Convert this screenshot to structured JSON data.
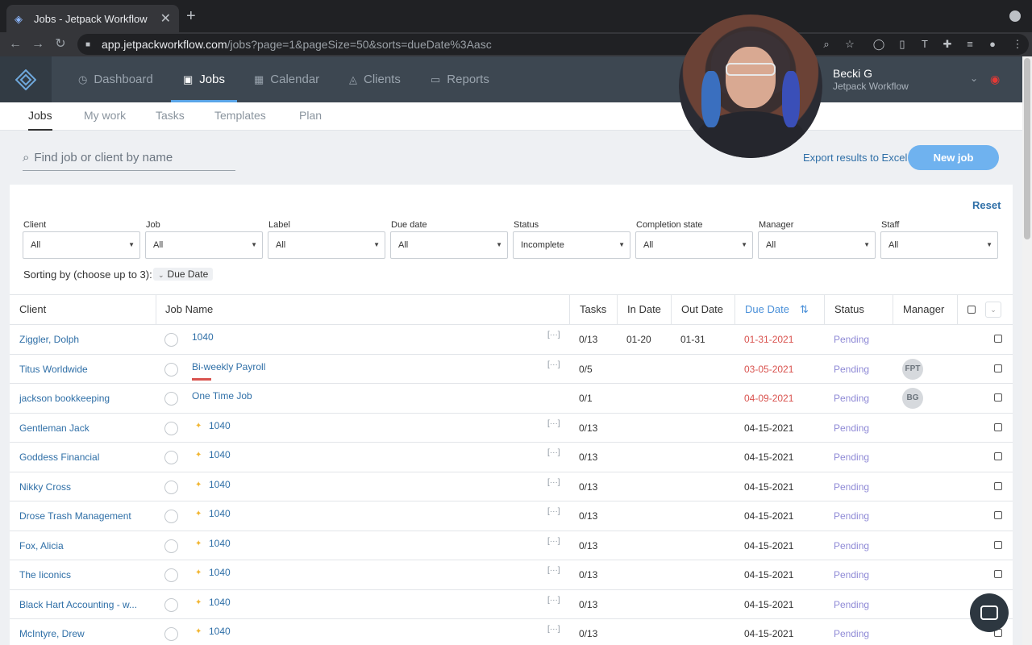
{
  "browser": {
    "tab_title": "Jobs - Jetpack Workflow",
    "url_host": "app.jetpackworkflow.com",
    "url_path": "/jobs?page=1&pageSize=50&sorts=dueDate%3Aasc"
  },
  "header": {
    "nav": [
      "Dashboard",
      "Jobs",
      "Calendar",
      "Clients",
      "Reports"
    ],
    "active_nav": "Jobs",
    "user_name": "Becki G",
    "user_org": "Jetpack Workflow"
  },
  "subnav": [
    "Jobs",
    "My work",
    "Tasks",
    "Templates",
    "Plan"
  ],
  "toolbar": {
    "search_placeholder": "Find job or client by name",
    "export_label": "Export results to Excel",
    "new_job_label": "New job"
  },
  "filters": {
    "reset_label": "Reset",
    "items": [
      {
        "label": "Client",
        "value": "All"
      },
      {
        "label": "Job",
        "value": "All"
      },
      {
        "label": "Label",
        "value": "All"
      },
      {
        "label": "Due date",
        "value": "All"
      },
      {
        "label": "Status",
        "value": "Incomplete"
      },
      {
        "label": "Completion state",
        "value": "All"
      },
      {
        "label": "Manager",
        "value": "All"
      },
      {
        "label": "Staff",
        "value": "All"
      }
    ],
    "sort_label": "Sorting by (choose up to 3):",
    "sort_chip": "Due Date"
  },
  "table": {
    "headers": {
      "client": "Client",
      "job_name": "Job Name",
      "tasks": "Tasks",
      "in_date": "In Date",
      "out_date": "Out Date",
      "due_date": "Due Date",
      "status": "Status",
      "manager": "Manager"
    },
    "rows": [
      {
        "client": "Ziggler, Dolph",
        "job": "1040",
        "tasks": "0/13",
        "in": "01-20",
        "out": "01-31",
        "due": "01-31-2021",
        "status": "Pending",
        "manager": ""
      },
      {
        "client": "Titus Worldwide",
        "job": "Bi-weekly Payroll",
        "tasks": "0/5",
        "in": "",
        "out": "",
        "due": "03-05-2021",
        "status": "Pending",
        "manager": "FPT"
      },
      {
        "client": "jackson bookkeeping",
        "job": "One Time Job",
        "tasks": "0/1",
        "in": "",
        "out": "",
        "due": "04-09-2021",
        "status": "Pending",
        "manager": "BG"
      },
      {
        "client": "Gentleman Jack",
        "job": "1040",
        "tasks": "0/13",
        "in": "",
        "out": "",
        "due": "04-15-2021",
        "status": "Pending",
        "manager": ""
      },
      {
        "client": "Goddess Financial",
        "job": "1040",
        "tasks": "0/13",
        "in": "",
        "out": "",
        "due": "04-15-2021",
        "status": "Pending",
        "manager": ""
      },
      {
        "client": "Nikky Cross",
        "job": "1040",
        "tasks": "0/13",
        "in": "",
        "out": "",
        "due": "04-15-2021",
        "status": "Pending",
        "manager": ""
      },
      {
        "client": "Drose Trash Management",
        "job": "1040",
        "tasks": "0/13",
        "in": "",
        "out": "",
        "due": "04-15-2021",
        "status": "Pending",
        "manager": ""
      },
      {
        "client": "Fox, Alicia",
        "job": "1040",
        "tasks": "0/13",
        "in": "",
        "out": "",
        "due": "04-15-2021",
        "status": "Pending",
        "manager": ""
      },
      {
        "client": "The Iiconics",
        "job": "1040",
        "tasks": "0/13",
        "in": "",
        "out": "",
        "due": "04-15-2021",
        "status": "Pending",
        "manager": ""
      },
      {
        "client": "Black Hart Accounting - w...",
        "job": "1040",
        "tasks": "0/13",
        "in": "",
        "out": "",
        "due": "04-15-2021",
        "status": "Pending",
        "manager": ""
      },
      {
        "client": "McIntyre, Drew",
        "job": "1040",
        "tasks": "0/13",
        "in": "",
        "out": "",
        "due": "04-15-2021",
        "status": "Pending",
        "manager": ""
      }
    ]
  },
  "colors": {
    "accent": "#4a90d9",
    "overdue": "#d9534f",
    "status": "#8f8ad6",
    "header_bg": "#3d4751"
  }
}
